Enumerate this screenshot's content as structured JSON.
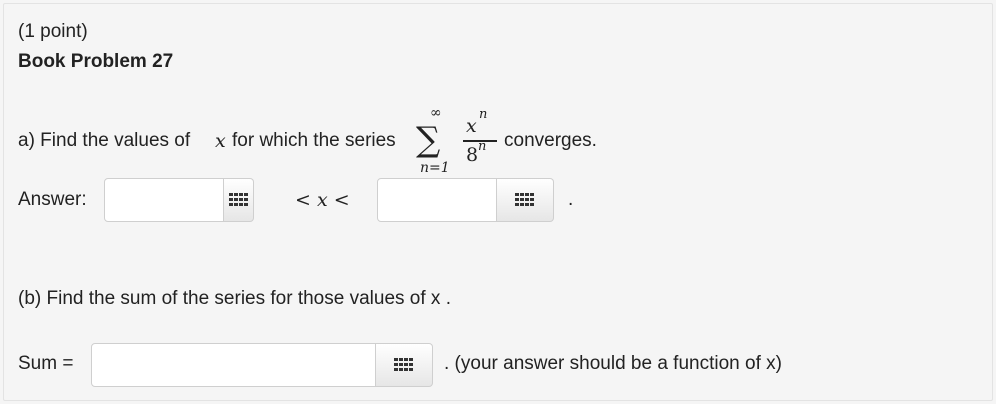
{
  "header": {
    "points": "(1 point)",
    "title": "Book Problem 27"
  },
  "part_a": {
    "prompt_prefix": "a) Find the values of",
    "prompt_var": "x",
    "prompt_middle": "for which the series",
    "sum_symbol": "∑",
    "sum_upper": "∞",
    "sum_lower": "n=1",
    "numerator_base": "x",
    "numerator_exp": "n",
    "denominator_base": "8",
    "denominator_exp": "n",
    "prompt_suffix": "converges.",
    "answer_label": "Answer:",
    "inequality": "< x <",
    "lower_value": "",
    "upper_value": "",
    "trailing": "."
  },
  "part_b": {
    "prompt": "(b) Find the sum of the series for those values of x .",
    "sum_label": "Sum =",
    "sum_value": "",
    "hint": ". (your answer should be a function of x)"
  },
  "icons": {
    "equation_tool": "grid-keypad-icon"
  },
  "colors": {
    "background": "#f5f5f5",
    "input_border": "#cfcfcf",
    "text": "#222222"
  }
}
